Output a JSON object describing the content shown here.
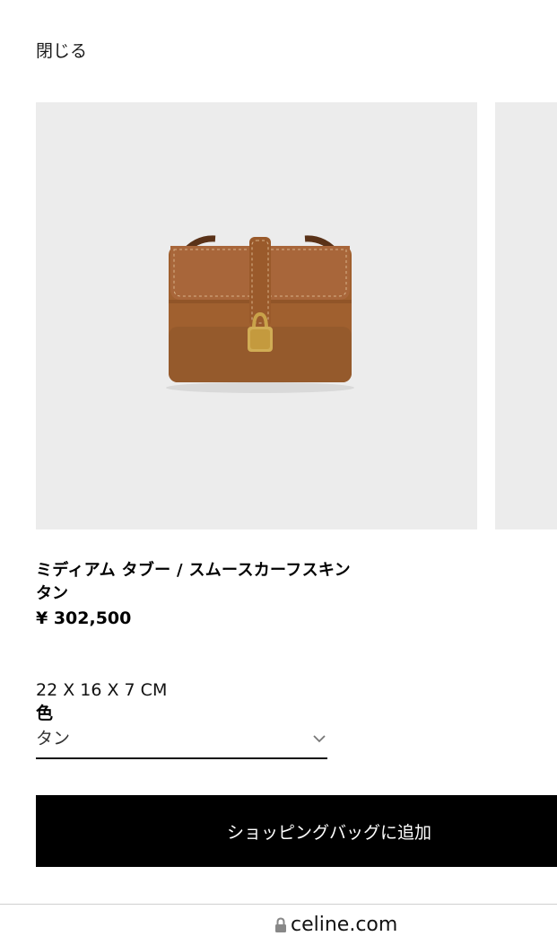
{
  "header": {
    "close_label": "閉じる"
  },
  "product": {
    "name": "ミディアム タブー / スムースカーフスキン",
    "color_line": "タン",
    "price": "¥ 302,500",
    "dimensions": "22 X 16 X 7 CM",
    "image_icon": "bag-image"
  },
  "color_selector": {
    "label": "色",
    "value": "タン"
  },
  "actions": {
    "add_to_bag_label": "ショッピングバッグに追加"
  },
  "browser": {
    "url": "celine.com"
  },
  "colors": {
    "image_bg": "#ececec",
    "bag_tan": "#a0602f",
    "button_bg": "#000000"
  }
}
